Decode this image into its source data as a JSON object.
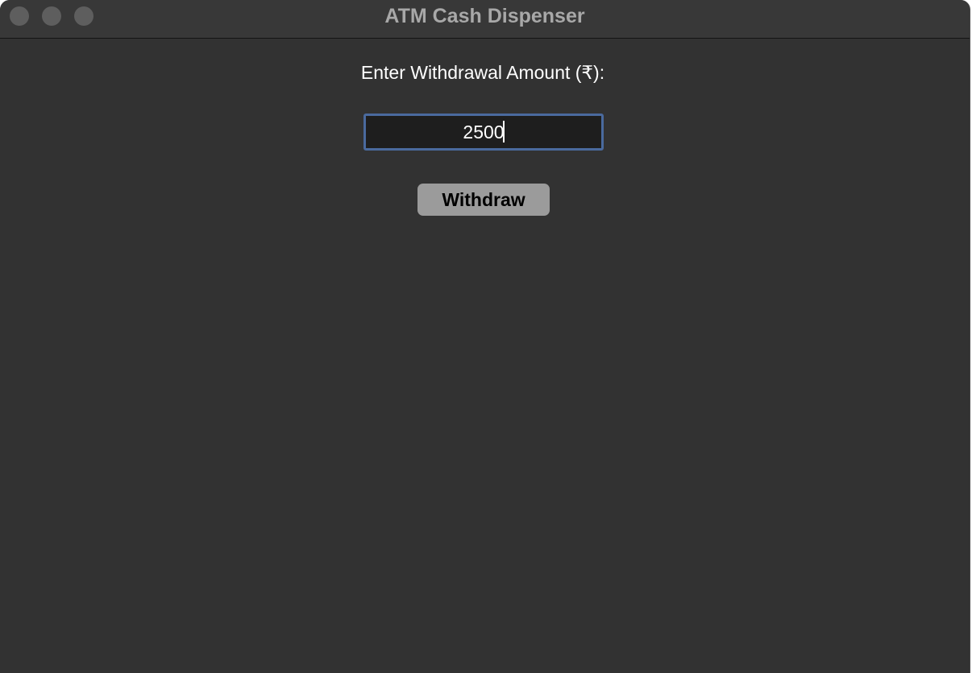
{
  "window": {
    "title": "ATM Cash Dispenser"
  },
  "form": {
    "amount_label": "Enter Withdrawal Amount (₹):",
    "amount_value": "2500",
    "withdraw_label": "Withdraw"
  },
  "colors": {
    "window_background": "#323232",
    "titlebar_background": "#383838",
    "input_border_focus": "#4a6a9e",
    "button_background": "#9b9b9b"
  },
  "icons": {
    "close": "close-dot-icon",
    "minimize": "minimize-dot-icon",
    "zoom": "zoom-dot-icon"
  }
}
